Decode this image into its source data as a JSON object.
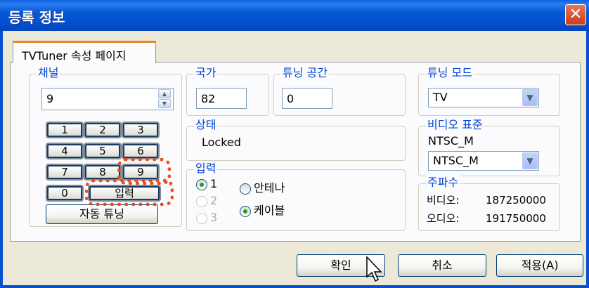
{
  "window": {
    "title": "등록 정보",
    "close_glyph": "✕"
  },
  "tab": {
    "label": "TVTuner 속성 페이지"
  },
  "channel": {
    "legend": "채널",
    "value": "9",
    "keypad": [
      "1",
      "2",
      "3",
      "4",
      "5",
      "6",
      "7",
      "8",
      "9",
      "0"
    ],
    "enter_label": "입력",
    "auto_tune_label": "자동 튜닝"
  },
  "country": {
    "legend": "국가",
    "value": "82"
  },
  "tuning_space": {
    "legend": "튜닝 공간",
    "value": "0"
  },
  "tuning_mode": {
    "legend": "튜닝 모드",
    "selected": "TV"
  },
  "status": {
    "legend": "상태",
    "value": "Locked"
  },
  "video_standard": {
    "legend": "비디오 표준",
    "current": "NTSC_M",
    "selected": "NTSC_M"
  },
  "input": {
    "legend": "입력",
    "numbers": [
      "1",
      "2",
      "3"
    ],
    "antenna_label": "안테나",
    "cable_label": "케이블"
  },
  "frequency": {
    "legend": "주파수",
    "video_label": "비디오:",
    "video_value": "187250000",
    "audio_label": "오디오:",
    "audio_value": "191750000"
  },
  "buttons": {
    "ok": "확인",
    "cancel": "취소",
    "apply": "적용(A)"
  },
  "colors": {
    "title_bar": "#0450cf",
    "highlight": "#ee4a14",
    "legend_text": "#0046d5"
  }
}
